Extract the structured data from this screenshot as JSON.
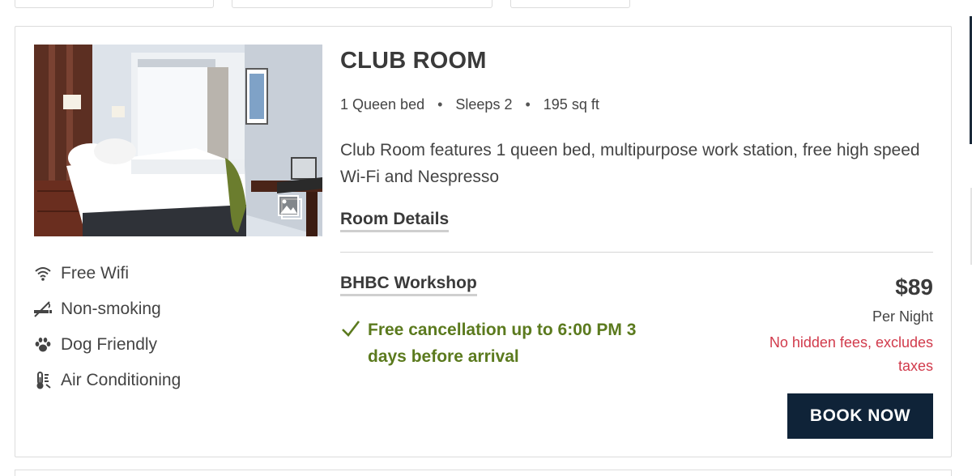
{
  "room": {
    "title": "CLUB ROOM",
    "specs": {
      "bed": "1 Queen bed",
      "sleeps": "Sleeps 2",
      "size": "195 sq ft",
      "separator": "•"
    },
    "description": "Club Room features 1 queen bed, multipurpose work station, free high speed Wi-Fi and Nespresso",
    "details_link": "Room Details",
    "photo_icon": "gallery-icon"
  },
  "amenities": [
    {
      "icon": "wifi-icon",
      "label": "Free Wifi"
    },
    {
      "icon": "no-smoking-icon",
      "label": "Non-smoking"
    },
    {
      "icon": "paw-icon",
      "label": "Dog Friendly"
    },
    {
      "icon": "thermometer-icon",
      "label": "Air Conditioning"
    }
  ],
  "rate": {
    "name": "BHBC Workshop",
    "cancellation": "Free cancellation up to 6:00 PM 3 days before arrival",
    "price": "$89",
    "per_night": "Per Night",
    "fees_note": "No hidden fees, excludes taxes",
    "book_label": "BOOK NOW"
  },
  "colors": {
    "cancellation_green": "#5b7a1e",
    "fees_red": "#d13a4b",
    "button_navy": "#0f2338",
    "text_dark": "#3a3a3a"
  }
}
